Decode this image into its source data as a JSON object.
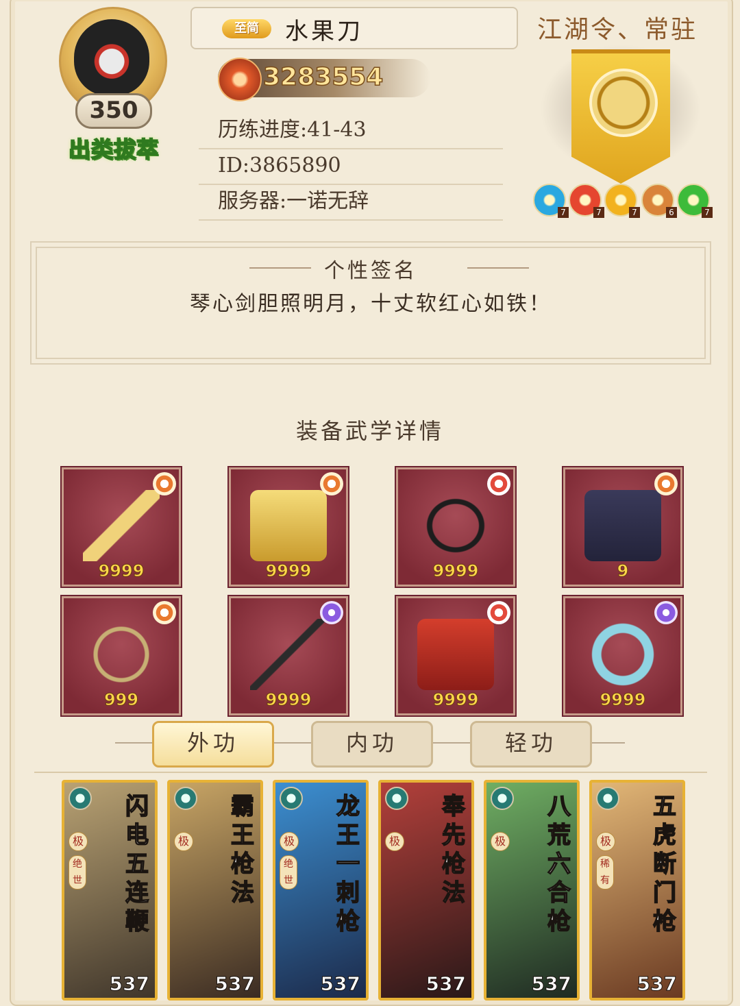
{
  "profile": {
    "level": "350",
    "title_badge": "出类拔萃",
    "rank_label": "至简",
    "name": "水果刀",
    "power": "3283554",
    "progress": "历练进度:41-43",
    "id": "ID:3865890",
    "server": "服务器:一诺无辞"
  },
  "jianghu": {
    "title": "江湖令、常驻",
    "gems": [
      {
        "color": "#2aa8e0",
        "level": "7"
      },
      {
        "color": "#e5462f",
        "level": "7"
      },
      {
        "color": "#f2b21e",
        "level": "7"
      },
      {
        "color": "#d9843a",
        "level": "6"
      },
      {
        "color": "#3dbb3a",
        "level": "7"
      }
    ]
  },
  "signature": {
    "title": "个性签名",
    "text": "琴心剑胆照明月，十丈软红心如铁！"
  },
  "equipment": {
    "title": "装备武学详情",
    "items": [
      {
        "icon": "staff-icon",
        "count": "9999",
        "mark": "orange"
      },
      {
        "icon": "robe-icon",
        "count": "9999",
        "mark": "orange"
      },
      {
        "icon": "belt-icon",
        "count": "9999",
        "mark": "red"
      },
      {
        "icon": "boots-icon",
        "count": "9",
        "mark": "orange"
      },
      {
        "icon": "necklace-icon",
        "count": "999",
        "mark": "orange"
      },
      {
        "icon": "hairpin-icon",
        "count": "9999",
        "mark": "purple"
      },
      {
        "icon": "bracer-icon",
        "count": "9999",
        "mark": "red"
      },
      {
        "icon": "ring-icon",
        "count": "9999",
        "mark": "purple"
      }
    ]
  },
  "tabs": [
    "外功",
    "内功",
    "轻功"
  ],
  "skills": [
    {
      "name": "闪电五连鞭",
      "rank": "极",
      "tag": "绝世",
      "level": "537"
    },
    {
      "name": "霸王枪法",
      "rank": "极",
      "tag": "",
      "level": "537"
    },
    {
      "name": "龙王一刺枪",
      "rank": "极",
      "tag": "绝世",
      "level": "537"
    },
    {
      "name": "奉先枪法",
      "rank": "极",
      "tag": "",
      "level": "537"
    },
    {
      "name": "八荒六合枪",
      "rank": "极",
      "tag": "",
      "level": "537"
    },
    {
      "name": "五虎断门枪",
      "rank": "极",
      "tag": "稀有",
      "level": "537"
    }
  ]
}
